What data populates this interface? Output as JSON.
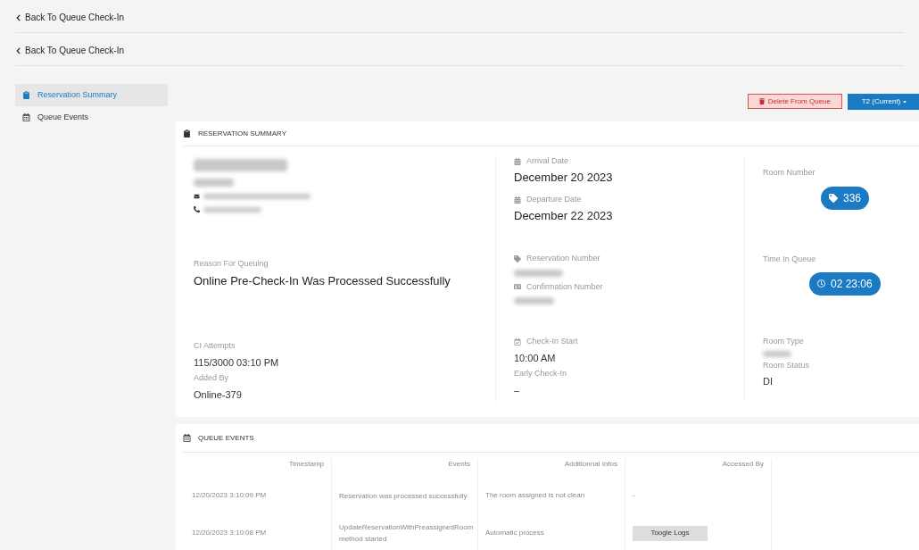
{
  "back_links": [
    "Back To Queue Check-In",
    "Back To Queue Check-In"
  ],
  "sidebar": {
    "items": [
      {
        "label": "Reservation Summary",
        "kind": "clipboard",
        "selected": true
      },
      {
        "label": "Queue Events",
        "kind": "calendar",
        "selected": false
      }
    ]
  },
  "actions": {
    "delete": "Delete From Queue",
    "terminal": "T2 (Current)"
  },
  "summary": {
    "title": "RESERVATION SUMMARY",
    "reason": {
      "label": "Reason For Queuing",
      "value": "Online Pre-Check-In Was Processed Successfully"
    },
    "ci_attempts": {
      "label": "CI Attempts",
      "value": "115/3000 03:10 PM"
    },
    "added_by": {
      "label": "Added By",
      "value": "Online-379"
    },
    "arrival": {
      "label": "Arrival Date",
      "value": "December 20 2023"
    },
    "departure": {
      "label": "Departure Date",
      "value": "December 22 2023"
    },
    "reservation_number": {
      "label": "Reservation Number"
    },
    "confirmation_number": {
      "label": "Confirmation Number"
    },
    "checkin_start": {
      "label": "Check-In Start",
      "value": "10:00 AM"
    },
    "early_checkin": {
      "label": "Early Check-In",
      "value": "–"
    },
    "room_number": {
      "label": "Room Number",
      "value": "336"
    },
    "time_in_queue": {
      "label": "Time In Queue",
      "value": "02 23:06"
    },
    "room_type": {
      "label": "Room Type"
    },
    "room_status": {
      "label": "Room Status",
      "value": "DI"
    }
  },
  "events": {
    "title": "QUEUE EVENTS",
    "columns": [
      "Timestamp",
      "Events",
      "Additionnal Infos",
      "Accessed By"
    ],
    "rows": [
      {
        "timestamp": "12/20/2023 3:10:09 PM",
        "event": "Reservation was processed successfully",
        "info": "The room assigned is not clean",
        "accessed_by": "-"
      },
      {
        "timestamp": "12/20/2023 3:10:08 PM",
        "event": "UpdateReservationWithPreassignedRoom method started",
        "info": "Automatic process",
        "button": "Toogle Logs"
      }
    ]
  }
}
